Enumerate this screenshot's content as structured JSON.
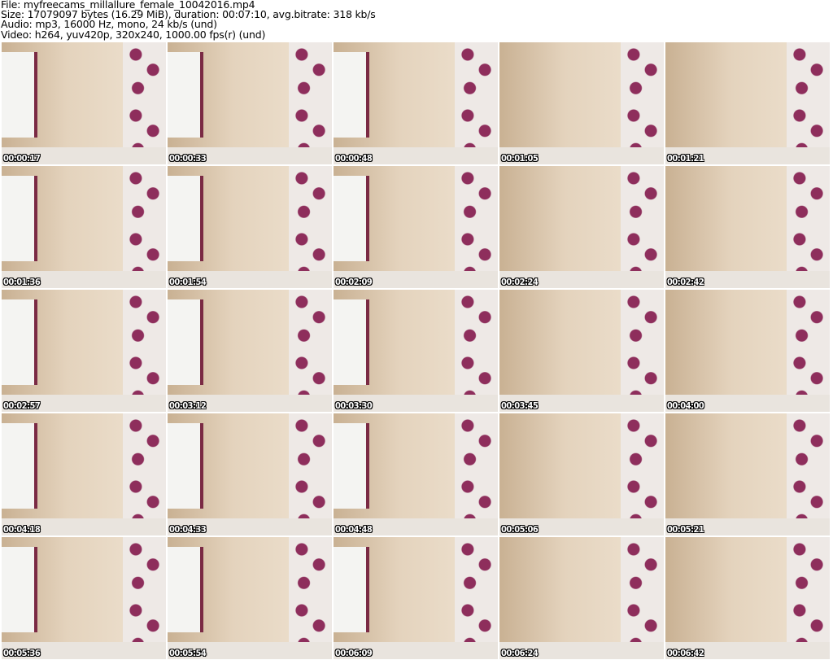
{
  "header": {
    "file": "File: myfreecams_millallure_female_10042016.mp4",
    "size": "Size: 17079097 bytes (16.29 MiB), duration: 00:07:10, avg.bitrate: 318 kb/s",
    "audio": "Audio: mp3, 16000 Hz, mono, 24 kb/s (und)",
    "video": "Video: h264, yuv420p, 320x240, 1000.00 fps(r) (und)"
  },
  "thumbnails": [
    "00:00:17",
    "00:00:33",
    "00:00:48",
    "00:01:05",
    "00:01:21",
    "00:01:36",
    "00:01:54",
    "00:02:09",
    "00:02:24",
    "00:02:42",
    "00:02:57",
    "00:03:12",
    "00:03:30",
    "00:03:45",
    "00:04:00",
    "00:04:18",
    "00:04:33",
    "00:04:48",
    "00:05:06",
    "00:05:21",
    "00:05:36",
    "00:05:54",
    "00:06:09",
    "00:06:24",
    "00:06:42"
  ]
}
